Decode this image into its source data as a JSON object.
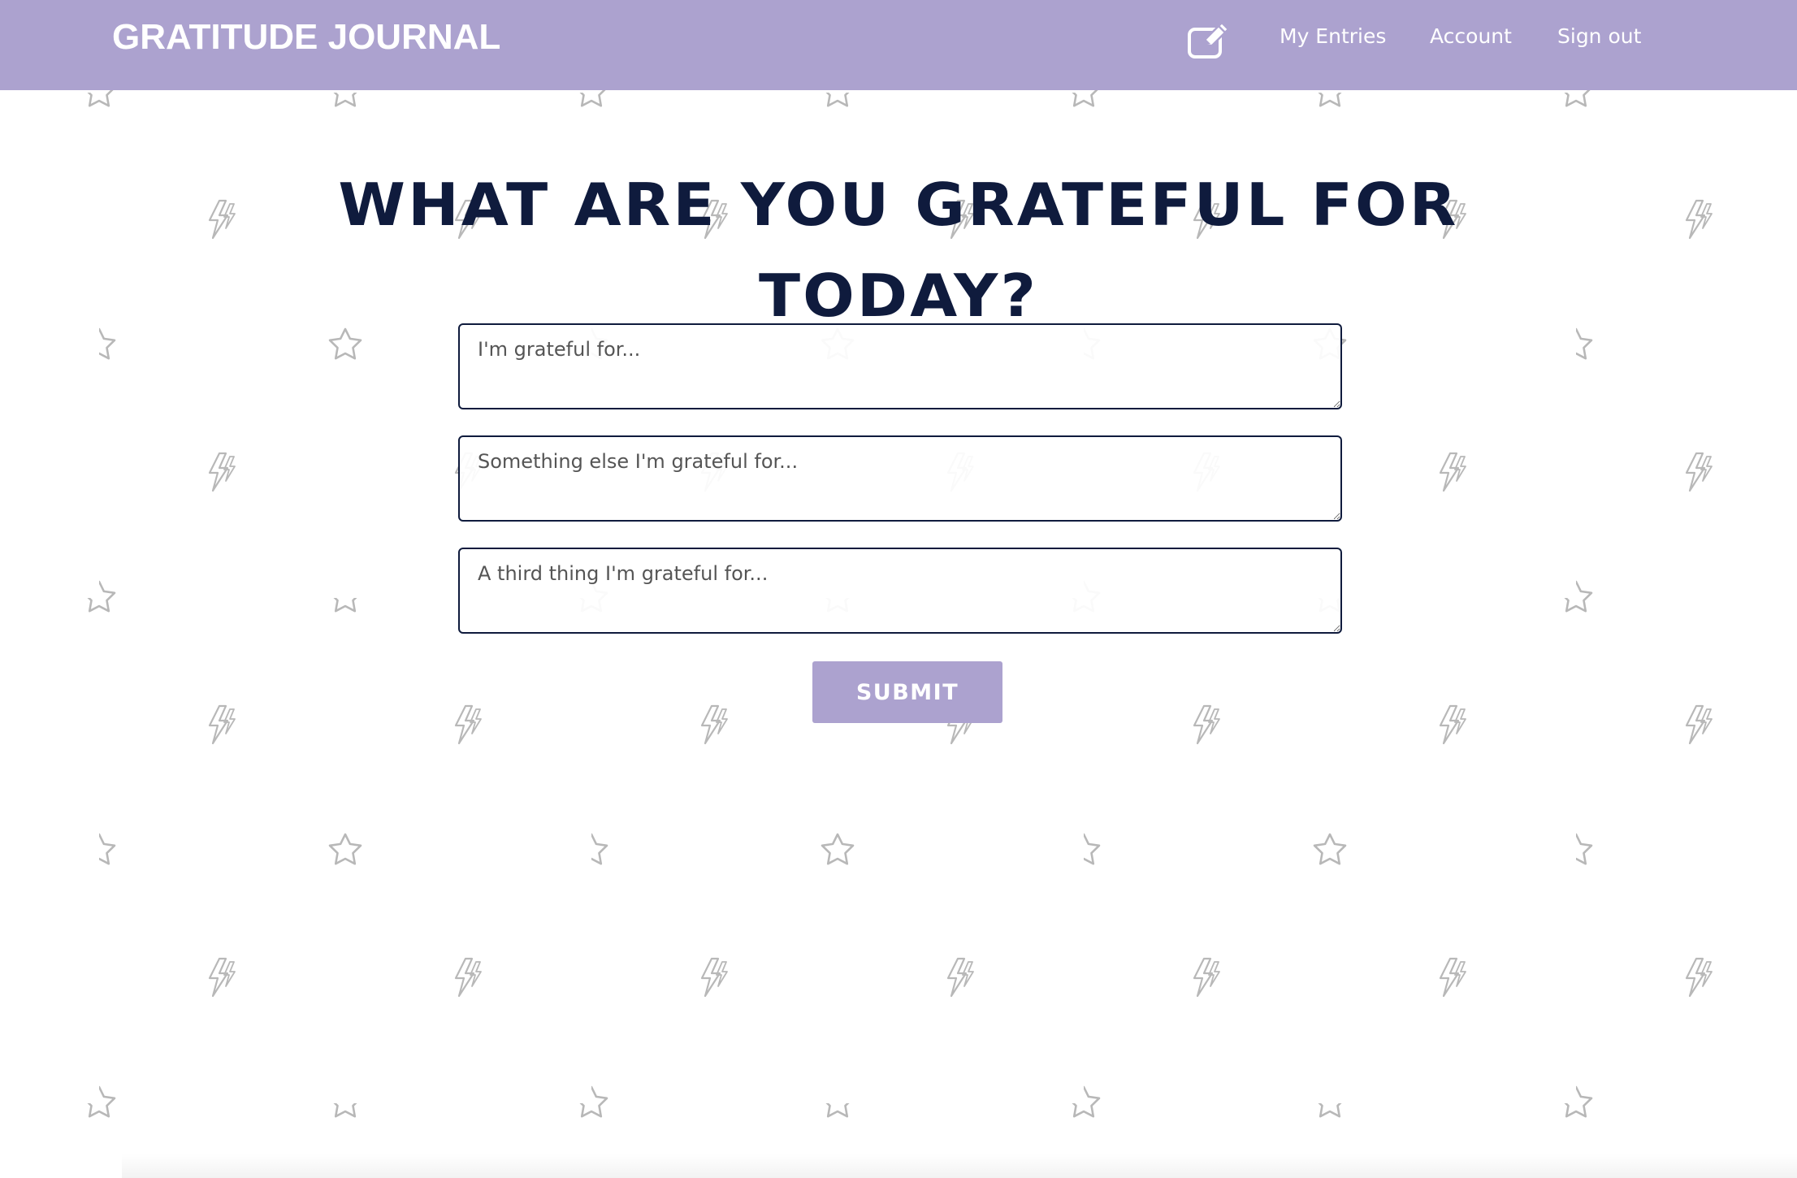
{
  "navbar": {
    "brand": "GRATITUDE JOURNAL",
    "edit_icon": "pencil-square-icon",
    "links": [
      "My Entries",
      "Account",
      "Sign out"
    ]
  },
  "main": {
    "headline_line1": "WHAT ARE YOU GRATEFUL FOR",
    "headline_line2": "TODAY?",
    "fields": [
      {
        "placeholder": "I'm grateful for...",
        "value": ""
      },
      {
        "placeholder": "Something else I'm grateful for...",
        "value": ""
      },
      {
        "placeholder": "A third thing I'm grateful for...",
        "value": ""
      }
    ],
    "submit_label": "SUBMIT"
  },
  "background": {
    "pattern_icons": [
      "star-icon",
      "lightning-bolt-icon"
    ]
  },
  "colors": {
    "accent": "#aca2cf",
    "heading": "#0f1b3d",
    "pattern": "#b8b8b8",
    "background": "#ffffff"
  }
}
